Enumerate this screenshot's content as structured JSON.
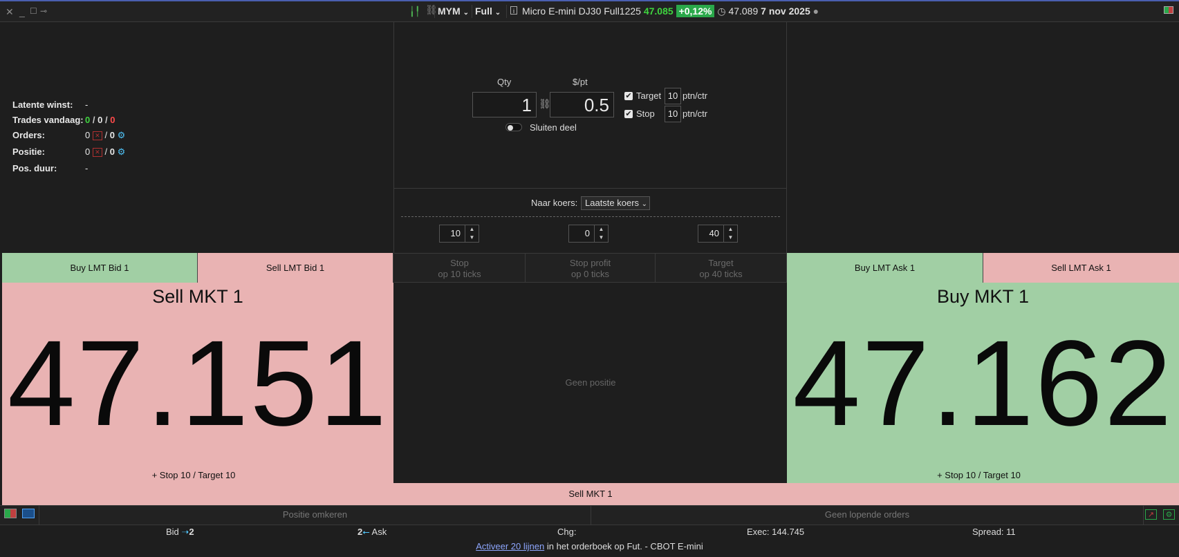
{
  "titlebar": {
    "symbol": "MYM",
    "mode": "Full",
    "instrument": "Micro E-mini DJ30 Full1225",
    "last_price": "47.085",
    "change_pct": "+0,12%",
    "quote_price": "47.089",
    "date": "7 nov 2025"
  },
  "left_info": {
    "unrealized_label": "Latente winst:",
    "unrealized_value": "-",
    "trades_label": "Trades vandaag:",
    "trades_green": "0",
    "trades_mid": "0",
    "trades_red": "0",
    "orders_label": "Orders:",
    "orders_a": "0",
    "orders_b": "0",
    "position_label": "Positie:",
    "position_a": "0",
    "position_b": "0",
    "duration_label": "Pos. duur:",
    "duration_value": "-"
  },
  "order_form": {
    "qty_label": "Qty",
    "qty_value": "1",
    "dpp_label": "$/pt",
    "dpp_value": "0.5",
    "target_label": "Target",
    "target_value": "10",
    "stop_label": "Stop",
    "stop_value": "10",
    "unit": "ptn/ctr",
    "close_part_label": "Sluiten deel"
  },
  "price_selector": {
    "label": "Naar koers:",
    "selected": "Laatste koers"
  },
  "steppers": {
    "stop": "10",
    "stop_profit": "0",
    "target": "40"
  },
  "row_buttons": {
    "buy_lmt_bid": "Buy LMT Bid 1",
    "sell_lmt_bid": "Sell LMT Bid 1",
    "stop_line1": "Stop",
    "stop_line2": "op 10 ticks",
    "stop_profit_line1": "Stop profit",
    "stop_profit_line2": "op 0 ticks",
    "target_line1": "Target",
    "target_line2": "op 40 ticks",
    "buy_lmt_ask": "Buy LMT Ask 1",
    "sell_lmt_ask": "Sell LMT Ask 1"
  },
  "sell_panel": {
    "title": "Sell MKT 1",
    "price": "47.151",
    "note": "+ Stop 10 / Target 10"
  },
  "buy_panel": {
    "title": "Buy MKT 1",
    "price": "47.162",
    "note": "+ Stop 10 / Target 10"
  },
  "center_status": "Geen positie",
  "sell_mkt_bar": "Sell MKT 1",
  "bottom": {
    "reverse_label": "Positie omkeren",
    "no_orders_label": "Geen lopende orders",
    "bid_label": "Bid",
    "bid_value": "2",
    "ask_value": "2",
    "ask_label": "Ask",
    "chg_label": "Chg:",
    "exec_label": "Exec:",
    "exec_value": "144.745",
    "spread_label": "Spread:",
    "spread_value": "11",
    "activate_link": "Activeer 20 lijnen",
    "activate_rest": "in het orderboek op Fut. - CBOT E-mini"
  },
  "colors": {
    "buy_green": "#a1cfa4",
    "sell_red": "#e9b3b3",
    "change_badge": "#2aa84a",
    "accent_cyan": "#4fc3f7"
  }
}
